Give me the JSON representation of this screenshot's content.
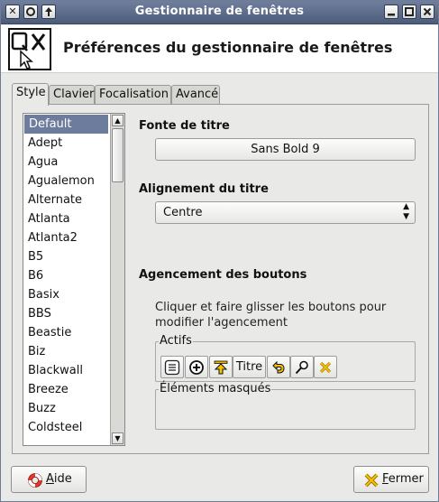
{
  "window": {
    "title": "Gestionnaire de fenêtres",
    "titlebar_left_buttons": [
      "✕",
      "◉",
      "↑"
    ],
    "titlebar_right_buttons": [
      "▁",
      "◻",
      "✕"
    ]
  },
  "header": {
    "title": "Préférences du gestionnaire de fenêtres",
    "icon": "window-manager-icon"
  },
  "tabs": [
    {
      "label": "Style",
      "active": true
    },
    {
      "label": "Clavier",
      "active": false
    },
    {
      "label": "Focalisation",
      "active": false
    },
    {
      "label": "Avancé",
      "active": false
    }
  ],
  "theme_list": {
    "selected": "Default",
    "items": [
      "Default",
      "Adept",
      "Agua",
      "Agualemon",
      "Alternate",
      "Atlanta",
      "Atlanta2",
      "B5",
      "B6",
      "Basix",
      "BBS",
      "Beastie",
      "Biz",
      "Blackwall",
      "Breeze",
      "Buzz",
      "Coldsteel"
    ]
  },
  "title_font": {
    "label": "Fonte de titre",
    "value": "Sans Bold 9"
  },
  "title_alignment": {
    "label": "Alignement du titre",
    "value": "Centre"
  },
  "button_layout": {
    "label": "Agencement des boutons",
    "description": "Cliquer et faire glisser les boutons pour modifier l'agencement",
    "active_label": "Actifs",
    "hidden_label": "Éléments masqués",
    "title_button": "Titre",
    "active_buttons": [
      "menu-icon",
      "stick-icon",
      "shade-icon",
      "Titre",
      "hide-icon",
      "maximize-icon",
      "close-icon"
    ]
  },
  "footer": {
    "help_label": "Aide",
    "help_mnemonic": "A",
    "help_rest": "ide",
    "close_label": "Fermer",
    "close_mnemonic": "F",
    "close_rest": "ermer"
  },
  "colors": {
    "titlebar": "#5d6c8a",
    "selection": "#6d7c9c",
    "window_bg": "#e9e9e7"
  }
}
